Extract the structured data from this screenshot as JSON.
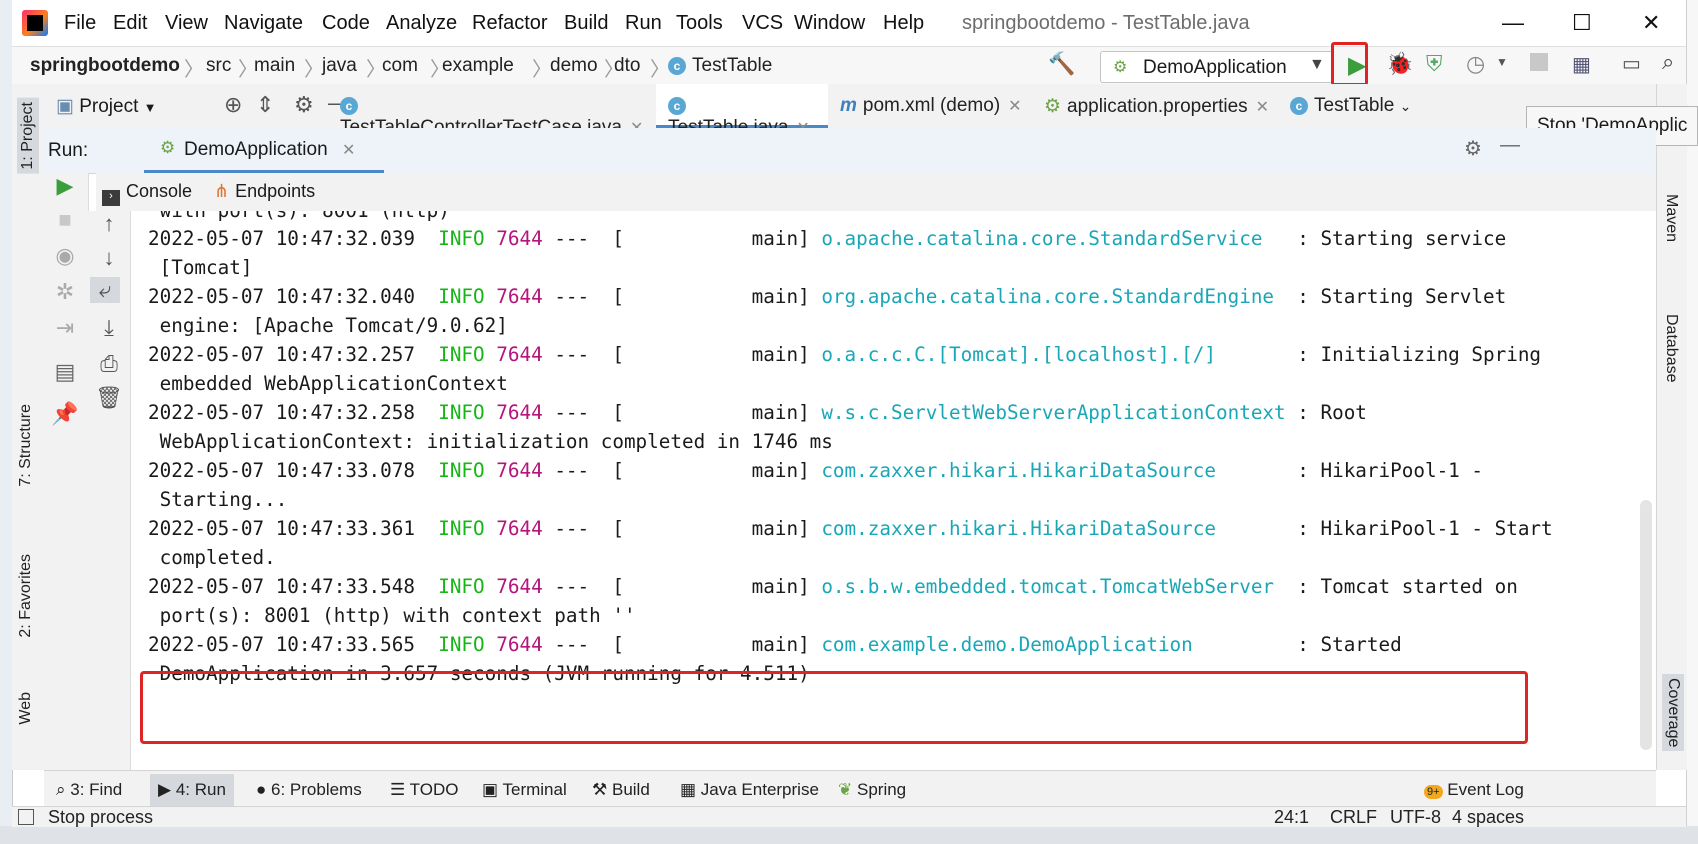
{
  "window": {
    "title": "springbootdemo - TestTable.java",
    "controls": {
      "minimize": "—",
      "maximize": "☐",
      "close": "✕"
    }
  },
  "menu": [
    "File",
    "Edit",
    "View",
    "Navigate",
    "Code",
    "Analyze",
    "Refactor",
    "Build",
    "Run",
    "Tools",
    "VCS",
    "Window",
    "Help"
  ],
  "breadcrumb": [
    "springbootdemo",
    "src",
    "main",
    "java",
    "com",
    "example",
    "demo",
    "dto",
    "TestTable"
  ],
  "run_config": {
    "name": "DemoApplication"
  },
  "tooltip": "Stop 'DemoApplic",
  "left_tool_windows": [
    "1: Project",
    "7: Structure",
    "2: Favorites",
    "Web"
  ],
  "right_tool_windows": [
    "Maven",
    "Database",
    "Coverage"
  ],
  "project_panel": {
    "label": "Project"
  },
  "editor_tabs": [
    {
      "label": "TestTableControllerTestCase.java",
      "icon": "C"
    },
    {
      "label": "TestTable.java",
      "icon": "C",
      "active": true
    },
    {
      "label": "pom.xml (demo)",
      "icon": "m"
    },
    {
      "label": "application.properties",
      "icon": "spring"
    },
    {
      "label": "TestTable",
      "icon": "C"
    }
  ],
  "run_panel": {
    "label": "Run:",
    "tab": "DemoApplication"
  },
  "console_tabs": [
    "Console",
    "Endpoints"
  ],
  "console_partial_top": " with port(s): 8001 (http)",
  "log": [
    {
      "ts": "2022-05-07 10:47:32.039",
      "level": "INFO",
      "pid": "7644",
      "thread": "---  [           main]",
      "logger": "o.apache.catalina.core.StandardService  ",
      "msg": ": Starting service",
      "cont": " [Tomcat]"
    },
    {
      "ts": "2022-05-07 10:47:32.040",
      "level": "INFO",
      "pid": "7644",
      "thread": "---  [           main]",
      "logger": "org.apache.catalina.core.StandardEngine ",
      "msg": ": Starting Servlet",
      "cont": " engine: [Apache Tomcat/9.0.62]"
    },
    {
      "ts": "2022-05-07 10:47:32.257",
      "level": "INFO",
      "pid": "7644",
      "thread": "---  [           main]",
      "logger": "o.a.c.c.C.[Tomcat].[localhost].[/]      ",
      "msg": ": Initializing Spring",
      "cont": " embedded WebApplicationContext"
    },
    {
      "ts": "2022-05-07 10:47:32.258",
      "level": "INFO",
      "pid": "7644",
      "thread": "---  [           main]",
      "logger": "w.s.c.ServletWebServerApplicationContext",
      "msg": ": Root",
      "cont": " WebApplicationContext: initialization completed in 1746 ms"
    },
    {
      "ts": "2022-05-07 10:47:33.078",
      "level": "INFO",
      "pid": "7644",
      "thread": "---  [           main]",
      "logger": "com.zaxxer.hikari.HikariDataSource      ",
      "msg": ": HikariPool-1 -",
      "cont": " Starting..."
    },
    {
      "ts": "2022-05-07 10:47:33.361",
      "level": "INFO",
      "pid": "7644",
      "thread": "---  [           main]",
      "logger": "com.zaxxer.hikari.HikariDataSource      ",
      "msg": ": HikariPool-1 - Start",
      "cont": " completed."
    },
    {
      "ts": "2022-05-07 10:47:33.548",
      "level": "INFO",
      "pid": "7644",
      "thread": "---  [           main]",
      "logger": "o.s.b.w.embedded.tomcat.TomcatWebServer ",
      "msg": ": Tomcat started on",
      "cont": " port(s): 8001 (http) with context path ''"
    },
    {
      "ts": "2022-05-07 10:47:33.565",
      "level": "INFO",
      "pid": "7644",
      "thread": "---  [           main]",
      "logger": "com.example.demo.DemoApplication        ",
      "msg": ": Started",
      "cont": " DemoApplication in 3.657 seconds (JVM running for 4.511)"
    }
  ],
  "bottom_tools": [
    "3: Find",
    "4: Run",
    "6: Problems",
    "TODO",
    "Terminal",
    "Build",
    "Java Enterprise",
    "Spring",
    "Event Log"
  ],
  "event_log_badge": "9+",
  "status": {
    "message": "Stop process",
    "position": "24:1",
    "line_sep": "CRLF",
    "encoding": "UTF-8",
    "indent": "4 spaces"
  },
  "colors": {
    "accent": "#4a88c7",
    "highlight": "#e02424",
    "info": "#17b517",
    "pid": "#b5157a",
    "logger": "#19a7b7"
  }
}
